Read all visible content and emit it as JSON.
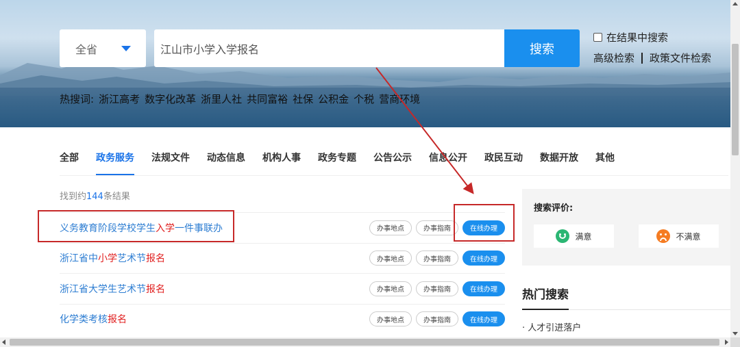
{
  "search": {
    "region": "全省",
    "query": "江山市小学入学报名",
    "button_label": "搜索",
    "in_results_label": "在结果中搜索",
    "advanced_label": "高级检索",
    "policy_label": "政策文件检索"
  },
  "hot": {
    "prefix": "热搜词:",
    "words": [
      "浙江高考",
      "数字化改革",
      "浙里人社",
      "共同富裕",
      "社保",
      "公积金",
      "个税",
      "营商环境"
    ]
  },
  "tabs": [
    "全部",
    "政务服务",
    "法规文件",
    "动态信息",
    "机构人事",
    "政务专题",
    "公告公示",
    "信息公开",
    "政民互动",
    "数据开放",
    "其他"
  ],
  "active_tab_index": 1,
  "result_count": {
    "prefix": "找到约",
    "number": "144",
    "suffix": "条结果"
  },
  "results": [
    {
      "parts": [
        {
          "t": "义务教育阶段学校学生",
          "hl": false
        },
        {
          "t": "入学",
          "hl": true
        },
        {
          "t": "一件事联办",
          "hl": false
        }
      ]
    },
    {
      "parts": [
        {
          "t": "浙江省中",
          "hl": false
        },
        {
          "t": "小学",
          "hl": true
        },
        {
          "t": "艺术节",
          "hl": false
        },
        {
          "t": "报名",
          "hl": true
        }
      ]
    },
    {
      "parts": [
        {
          "t": "浙江省大学生艺术节",
          "hl": false
        },
        {
          "t": "报名",
          "hl": true
        }
      ]
    },
    {
      "parts": [
        {
          "t": "化学类考核",
          "hl": false
        },
        {
          "t": "报名",
          "hl": true
        }
      ]
    }
  ],
  "actions": {
    "location": "办事地点",
    "guide": "办事指南",
    "online": "在线办理"
  },
  "evaluation": {
    "title": "搜索评价:",
    "satisfied": "满意",
    "unsatisfied": "不满意"
  },
  "hot_search": {
    "title": "热门搜索",
    "items": [
      "· 人才引进落户"
    ]
  },
  "colors": {
    "accent": "#1a8fee",
    "highlight": "#e02020",
    "annotation": "#c62828",
    "happy": "#2bb673",
    "sad": "#f57c22"
  }
}
